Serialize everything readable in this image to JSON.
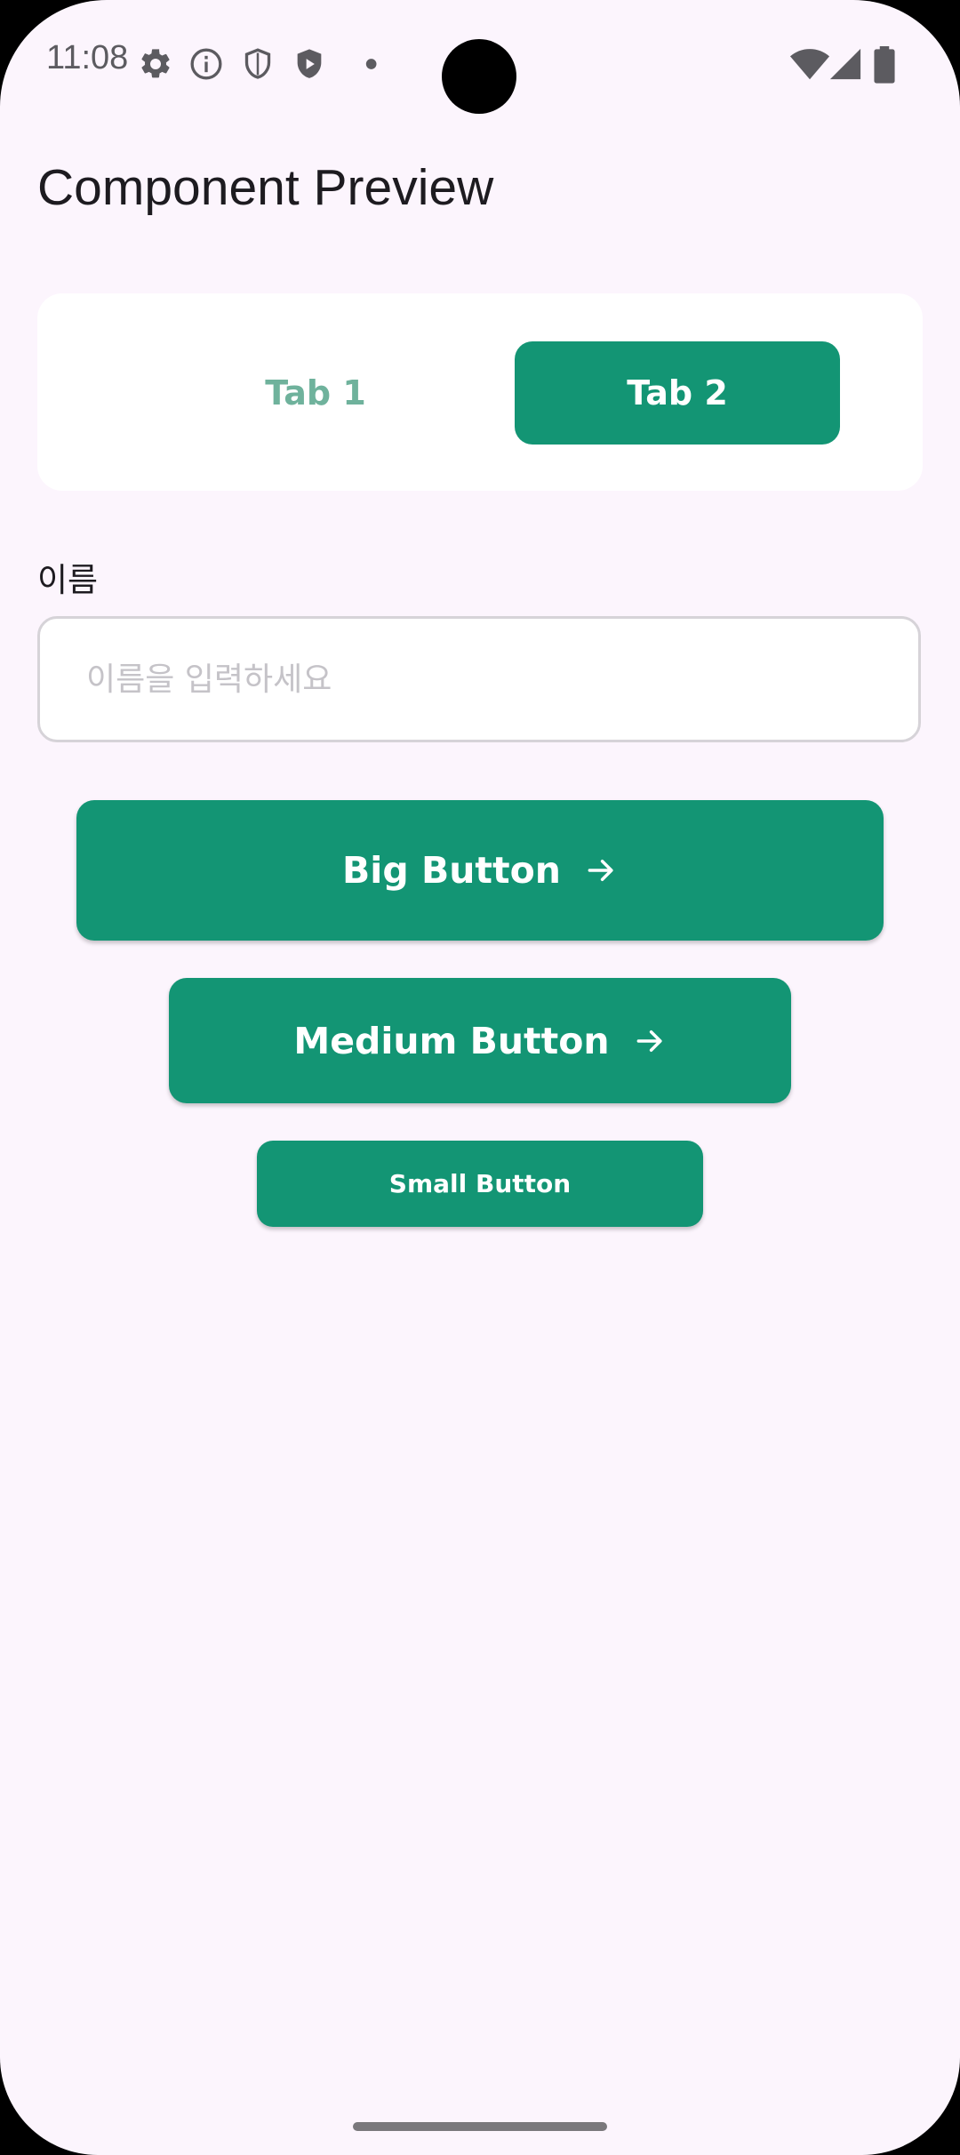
{
  "status_bar": {
    "time": "11:08",
    "icons": [
      "gear-icon",
      "info-icon",
      "shield-icon",
      "play-shield-icon",
      "dot-icon",
      "wifi-icon",
      "cellular-icon",
      "battery-icon"
    ]
  },
  "app_bar": {
    "title": "Component Preview"
  },
  "tabs": [
    {
      "label": "Tab 1",
      "selected": false
    },
    {
      "label": "Tab 2",
      "selected": true
    }
  ],
  "form": {
    "name_label": "이름",
    "name_placeholder": "이름을 입력하세요",
    "name_value": ""
  },
  "buttons": {
    "big_label": "Big Button",
    "medium_label": "Medium Button",
    "small_label": "Small Button",
    "arrow_icon": "arrow-right-icon"
  },
  "colors": {
    "accent": "#139574",
    "background": "#FCF5FD",
    "tab_inactive_text": "#6fb29c"
  }
}
